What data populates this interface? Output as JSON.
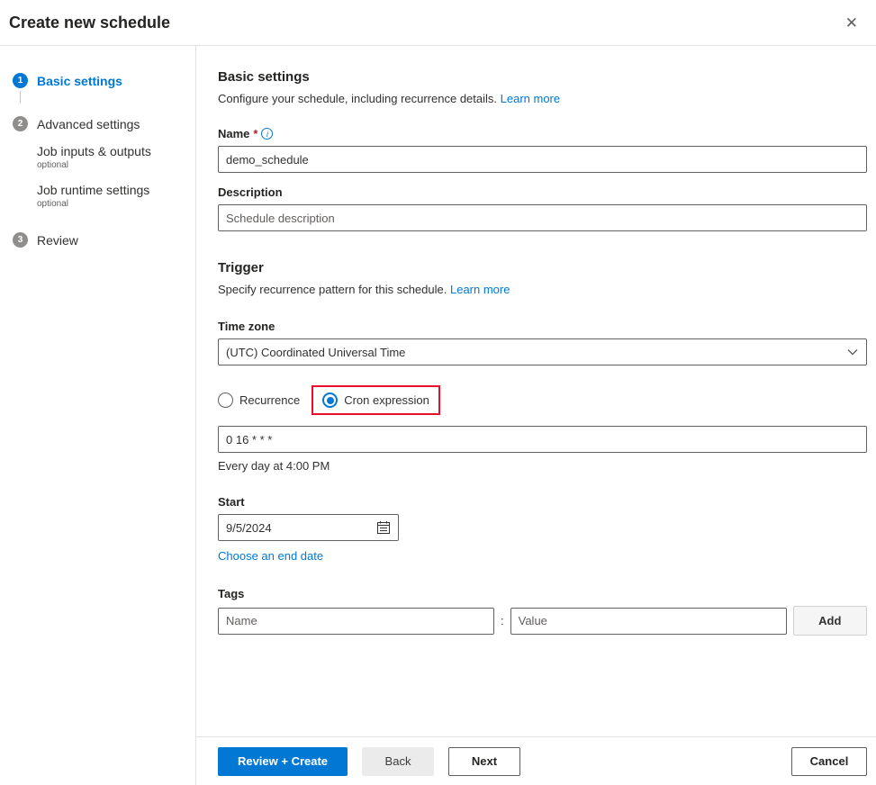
{
  "dialog": {
    "title": "Create new schedule",
    "close_glyph": "✕"
  },
  "stepper": {
    "steps": [
      {
        "number": "1",
        "label": "Basic settings",
        "active": true
      },
      {
        "number": "2",
        "label": "Advanced settings",
        "active": false,
        "sub_items": [
          {
            "label": "Job inputs & outputs",
            "note": "optional"
          },
          {
            "label": "Job runtime settings",
            "note": "optional"
          }
        ]
      },
      {
        "number": "3",
        "label": "Review",
        "active": false
      }
    ]
  },
  "main": {
    "section_title": "Basic settings",
    "section_desc": "Configure your schedule, including recurrence details.",
    "section_learn_more": "Learn more",
    "name_label": "Name",
    "required_mark": "*",
    "info_glyph": "i",
    "name_value": "demo_schedule",
    "description_label": "Description",
    "description_placeholder": "Schedule description",
    "trigger_title": "Trigger",
    "trigger_desc": "Specify recurrence pattern for this schedule.",
    "trigger_learn_more": "Learn more",
    "timezone_label": "Time zone",
    "timezone_value": "(UTC) Coordinated Universal Time",
    "recurrence_radio_label": "Recurrence",
    "cron_radio_label": "Cron expression",
    "cron_value": "0 16 * * *",
    "cron_help_text": "Every day at 4:00 PM",
    "start_label": "Start",
    "start_value": "9/5/2024",
    "end_date_link": "Choose an end date",
    "tags_label": "Tags",
    "tag_name_placeholder": "Name",
    "tag_value_placeholder": "Value",
    "tag_separator": ":",
    "add_button_label": "Add"
  },
  "footer": {
    "review_create_label": "Review + Create",
    "back_label": "Back",
    "next_label": "Next",
    "cancel_label": "Cancel"
  },
  "colors": {
    "primary_blue": "#0078d4",
    "highlight_red": "#e8112d",
    "step_inactive_gray": "#8f8e8d",
    "required_red": "#a4262c"
  }
}
